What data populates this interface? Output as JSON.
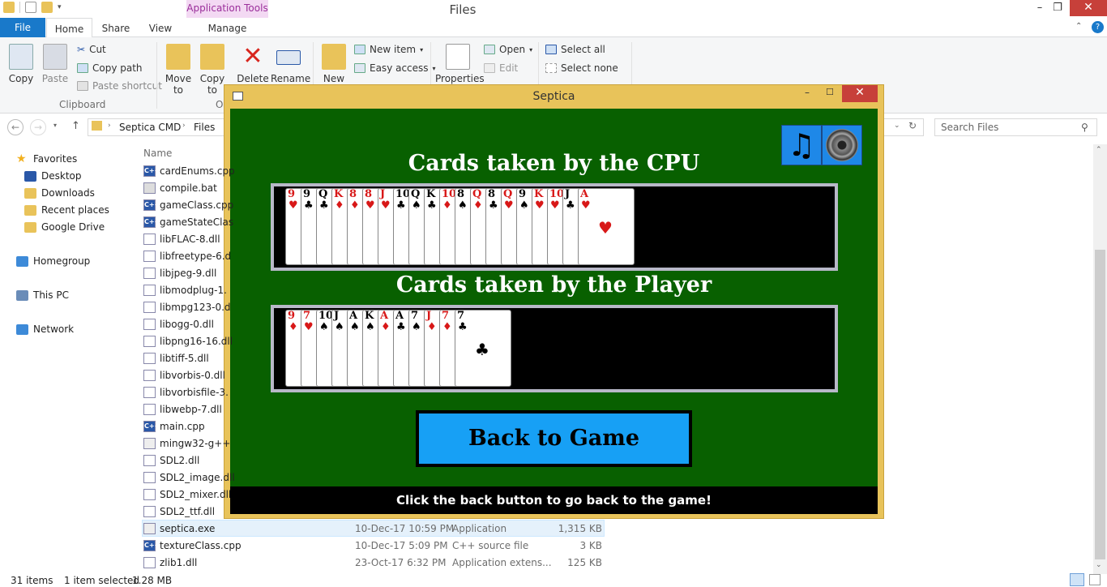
{
  "explorer": {
    "title": "Files",
    "app_tools_label": "Application Tools",
    "tabs": {
      "file": "File",
      "home": "Home",
      "share": "Share",
      "view": "View",
      "manage": "Manage"
    },
    "ribbon": {
      "copy": "Copy",
      "paste": "Paste",
      "cut": "Cut",
      "copy_path": "Copy path",
      "paste_shortcut": "Paste shortcut",
      "clipboard_group": "Clipboard",
      "move_to": "Move to",
      "copy_to": "Copy to",
      "delete": "Delete",
      "rename": "Rename",
      "organize_group": "O",
      "new": "New",
      "new_item": "New item",
      "easy_access": "Easy access",
      "properties": "Properties",
      "open": "Open",
      "edit": "Edit",
      "select_all": "Select all",
      "select_none": "Select none"
    },
    "address": {
      "crumb1": "Septica CMD",
      "crumb2": "Files",
      "search_placeholder": "Search Files"
    },
    "nav": [
      {
        "label": "Favorites",
        "icon": "star-icon"
      },
      {
        "label": "Desktop",
        "icon": "desktop-icon"
      },
      {
        "label": "Downloads",
        "icon": "folder-icon"
      },
      {
        "label": "Recent places",
        "icon": "folder-icon"
      },
      {
        "label": "Google Drive",
        "icon": "folder-icon"
      },
      {
        "label": "Homegroup",
        "icon": "homegroup-icon"
      },
      {
        "label": "This PC",
        "icon": "pc-icon"
      },
      {
        "label": "Network",
        "icon": "network-icon"
      }
    ],
    "column_name": "Name",
    "files": [
      {
        "name": "cardEnums.cpp",
        "type": "cpp"
      },
      {
        "name": "compile.bat",
        "type": "bat"
      },
      {
        "name": "gameClass.cpp",
        "type": "cpp"
      },
      {
        "name": "gameStateClas",
        "type": "cpp"
      },
      {
        "name": "libFLAC-8.dll",
        "type": "dll"
      },
      {
        "name": "libfreetype-6.d",
        "type": "dll"
      },
      {
        "name": "libjpeg-9.dll",
        "type": "dll"
      },
      {
        "name": "libmodplug-1.",
        "type": "dll"
      },
      {
        "name": "libmpg123-0.d",
        "type": "dll"
      },
      {
        "name": "libogg-0.dll",
        "type": "dll"
      },
      {
        "name": "libpng16-16.dll",
        "type": "dll"
      },
      {
        "name": "libtiff-5.dll",
        "type": "dll"
      },
      {
        "name": "libvorbis-0.dll",
        "type": "dll"
      },
      {
        "name": "libvorbisfile-3.",
        "type": "dll"
      },
      {
        "name": "libwebp-7.dll",
        "type": "dll"
      },
      {
        "name": "main.cpp",
        "type": "cpp"
      },
      {
        "name": "mingw32-g++",
        "type": "exe"
      },
      {
        "name": "SDL2.dll",
        "type": "dll"
      },
      {
        "name": "SDL2_image.dll",
        "type": "dll"
      },
      {
        "name": "SDL2_mixer.dll",
        "type": "dll"
      },
      {
        "name": "SDL2_ttf.dll",
        "type": "dll"
      }
    ],
    "detailed_files": [
      {
        "name": "septica.exe",
        "date": "10-Dec-17 10:59 PM",
        "type": "Application",
        "size": "1,315 KB",
        "icon": "exe"
      },
      {
        "name": "textureClass.cpp",
        "date": "10-Dec-17 5:09 PM",
        "type": "C++ source file",
        "size": "3 KB",
        "icon": "cpp"
      },
      {
        "name": "zlib1.dll",
        "date": "23-Oct-17 6:32 PM",
        "type": "Application extens...",
        "size": "125 KB",
        "icon": "dll"
      }
    ],
    "status": {
      "items": "31 items",
      "selected": "1 item selected",
      "size": "1.28 MB"
    }
  },
  "septica": {
    "title": "Septica",
    "cpu_heading": "Cards taken by the CPU",
    "player_heading": "Cards taken by the Player",
    "back_button": "Back to Game",
    "hint": "Click the back button to go back to the game!",
    "cpu_cards": [
      {
        "rank": "9",
        "suit": "♥"
      },
      {
        "rank": "9",
        "suit": "♣"
      },
      {
        "rank": "Q",
        "suit": "♣"
      },
      {
        "rank": "K",
        "suit": "♦"
      },
      {
        "rank": "8",
        "suit": "♦"
      },
      {
        "rank": "8",
        "suit": "♥"
      },
      {
        "rank": "J",
        "suit": "♥"
      },
      {
        "rank": "10",
        "suit": "♣"
      },
      {
        "rank": "Q",
        "suit": "♠"
      },
      {
        "rank": "K",
        "suit": "♣"
      },
      {
        "rank": "10",
        "suit": "♦"
      },
      {
        "rank": "8",
        "suit": "♠"
      },
      {
        "rank": "Q",
        "suit": "♦"
      },
      {
        "rank": "8",
        "suit": "♣"
      },
      {
        "rank": "Q",
        "suit": "♥"
      },
      {
        "rank": "9",
        "suit": "♠"
      },
      {
        "rank": "K",
        "suit": "♥"
      },
      {
        "rank": "10",
        "suit": "♥"
      },
      {
        "rank": "J",
        "suit": "♣"
      },
      {
        "rank": "A",
        "suit": "♥"
      }
    ],
    "player_cards": [
      {
        "rank": "9",
        "suit": "♦"
      },
      {
        "rank": "7",
        "suit": "♥"
      },
      {
        "rank": "10",
        "suit": "♠"
      },
      {
        "rank": "J",
        "suit": "♠"
      },
      {
        "rank": "A",
        "suit": "♠"
      },
      {
        "rank": "K",
        "suit": "♠"
      },
      {
        "rank": "A",
        "suit": "♦"
      },
      {
        "rank": "A",
        "suit": "♣"
      },
      {
        "rank": "7",
        "suit": "♠"
      },
      {
        "rank": "J",
        "suit": "♦"
      },
      {
        "rank": "7",
        "suit": "♦"
      },
      {
        "rank": "7",
        "suit": "♣"
      }
    ]
  }
}
